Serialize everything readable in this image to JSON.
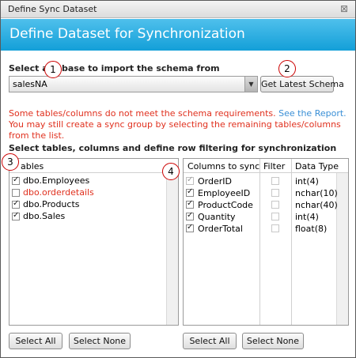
{
  "window": {
    "title": "Define Sync Dataset",
    "close_glyph": "⊠"
  },
  "header": {
    "heading": "Define Dataset for Synchronization"
  },
  "database": {
    "label_part1": "Select a",
    "label_part2": "base to import the schema from",
    "selected": "salesNA",
    "latest_schema_button": "Get Latest Schema"
  },
  "warning": {
    "text_before": "Some tables/columns do not meet the schema requirements.",
    "link": "See the Report.",
    "text_after": "You may still create a sync group by selecting the remaining tables/columns from the list."
  },
  "section_label": "Select tables, columns and define row filtering for synchronization",
  "tables_panel": {
    "header": "ables",
    "items": [
      {
        "name": "dbo.Employees",
        "checked": true,
        "invalid": false
      },
      {
        "name": "dbo.orderdetails",
        "checked": false,
        "invalid": true
      },
      {
        "name": "dbo.Products",
        "checked": true,
        "invalid": false
      },
      {
        "name": "dbo.Sales",
        "checked": true,
        "invalid": false
      }
    ],
    "select_all": "Select All",
    "select_none": "Select None"
  },
  "columns_panel": {
    "headers": {
      "column": "Columns to sync",
      "filter": "Filter",
      "type": "Data Type"
    },
    "rows": [
      {
        "name": "OrderID",
        "checked": true,
        "disabled": true,
        "filter": false,
        "type": "int(4)"
      },
      {
        "name": "EmployeeID",
        "checked": true,
        "disabled": false,
        "filter": false,
        "type": "nchar(10)"
      },
      {
        "name": "ProductCode",
        "checked": true,
        "disabled": false,
        "filter": false,
        "type": "nchar(40)"
      },
      {
        "name": "Quantity",
        "checked": true,
        "disabled": false,
        "filter": false,
        "type": "int(4)"
      },
      {
        "name": "OrderTotal",
        "checked": true,
        "disabled": false,
        "filter": false,
        "type": "float(8)"
      }
    ],
    "select_all": "Select All",
    "select_none": "Select None"
  },
  "markers": [
    "1",
    "2",
    "3",
    "4"
  ],
  "colors": {
    "header_blue": "#139fd8",
    "warning_red": "#e0301e",
    "link_blue": "#3a8fd6",
    "invalid_red": "#e0301e"
  }
}
